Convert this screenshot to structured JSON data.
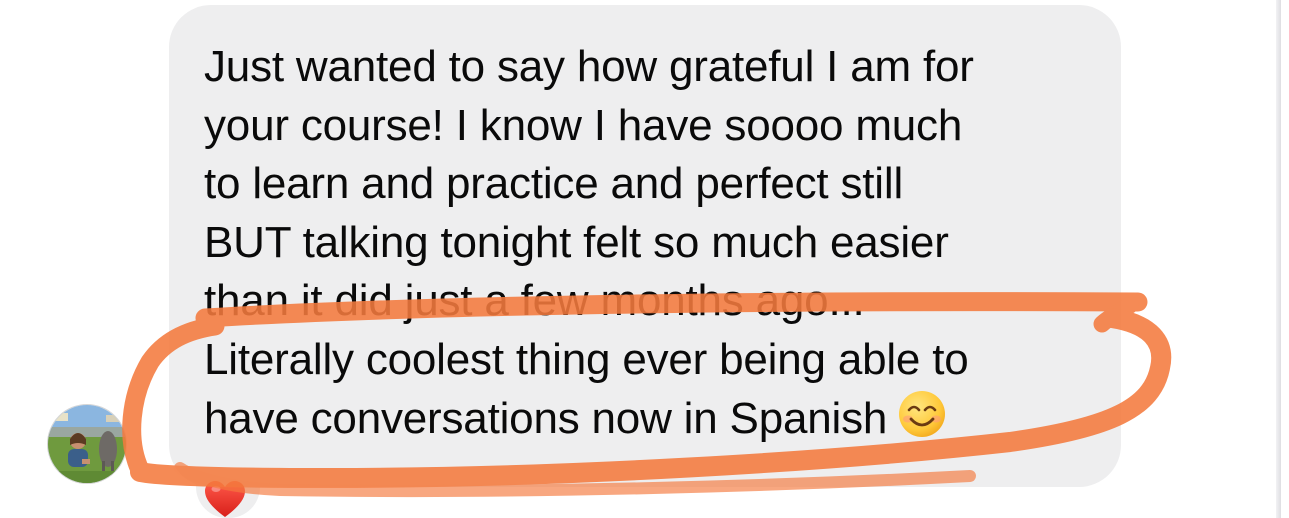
{
  "message": {
    "lines": [
      "Just wanted to say how grateful I am for",
      "your course! I know I have soooo much",
      "to learn and practice and perfect still",
      "BUT talking tonight felt so much easier",
      "than it did just a few months ago...",
      "Literally coolest thing ever being able to",
      "have conversations now in Spanish"
    ],
    "emoji_icon": "smiling-face-emoji",
    "bubble_color": "#eeeeef",
    "text_color": "#0a0a0a"
  },
  "reaction": {
    "icon": "heart-icon",
    "color": "#e8332a"
  },
  "sender": {
    "avatar_icon": "profile-photo"
  },
  "annotation": {
    "type": "hand-drawn-loop",
    "color": "#f47a3e"
  }
}
